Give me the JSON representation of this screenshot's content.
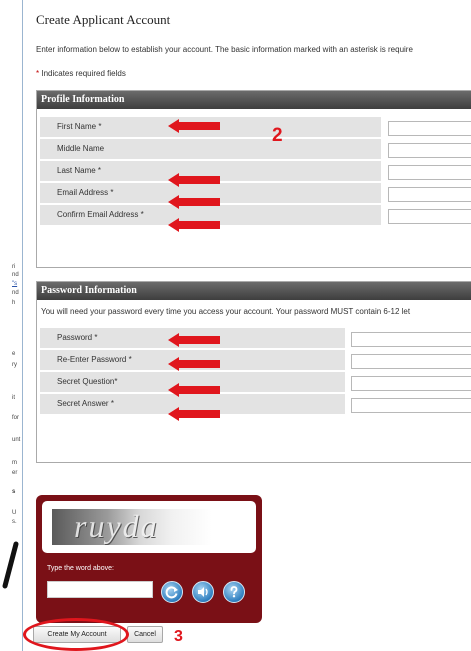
{
  "page": {
    "title": "Create Applicant Account",
    "intro": "Enter information below to establish your account. The basic information marked with an asterisk is require",
    "required_note": "Indicates required fields",
    "required_star": "*"
  },
  "profile": {
    "header": "Profile Information",
    "fields": [
      {
        "label": "First Name",
        "required": true
      },
      {
        "label": "Middle Name",
        "required": false
      },
      {
        "label": "Last Name",
        "required": true
      },
      {
        "label": "Email Address",
        "required": true
      },
      {
        "label": "Confirm Email Address",
        "required": true
      }
    ]
  },
  "password": {
    "header": "Password Information",
    "intro": "You will need your password every time you access your account. Your password MUST contain 6-12 let",
    "fields": [
      {
        "label": "Password",
        "required": true
      },
      {
        "label": "Re-Enter Password",
        "required": true
      },
      {
        "label": "Secret Question",
        "required": true
      },
      {
        "label": "Secret Answer",
        "required": true
      }
    ]
  },
  "captcha": {
    "word": "ruyda",
    "label": "Type the word above:",
    "buttons": [
      "refresh-icon",
      "audio-icon",
      "help-icon"
    ]
  },
  "actions": {
    "create": "Create My Account",
    "cancel": "Cancel"
  },
  "annotations": {
    "step_2": "2",
    "step_3": "3",
    "color": "#e0161d"
  },
  "left_strip": {
    "lines": [
      "ri",
      "nd",
      "\"s",
      "nd",
      "h",
      "e",
      "ry",
      "it",
      "for",
      "unt",
      "m",
      "er",
      "s",
      "U",
      "s."
    ]
  }
}
